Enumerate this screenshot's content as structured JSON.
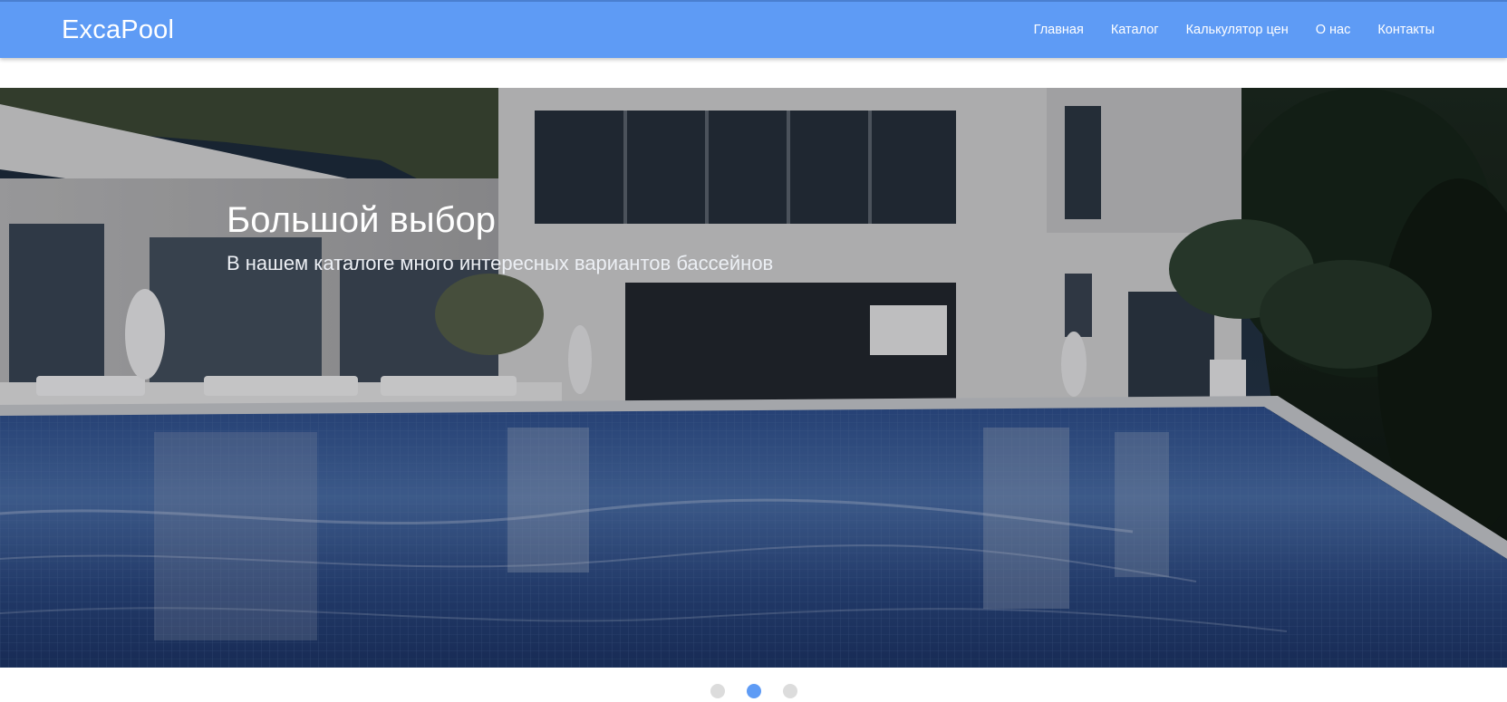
{
  "navbar": {
    "brand": "ExcaPool",
    "background": "#5e9bf5",
    "items": [
      {
        "label": "Главная"
      },
      {
        "label": "Каталог"
      },
      {
        "label": "Калькулятор цен"
      },
      {
        "label": "О нас"
      },
      {
        "label": "Контакты"
      }
    ]
  },
  "slider": {
    "title": "Большой выбор",
    "subtitle": "В нашем каталоге много интересных вариантов бассейнов",
    "active_slide": 2,
    "slide_count": 3,
    "dot_active_color": "#5e9bf5",
    "dot_inactive_color": "#dcdcdc"
  }
}
